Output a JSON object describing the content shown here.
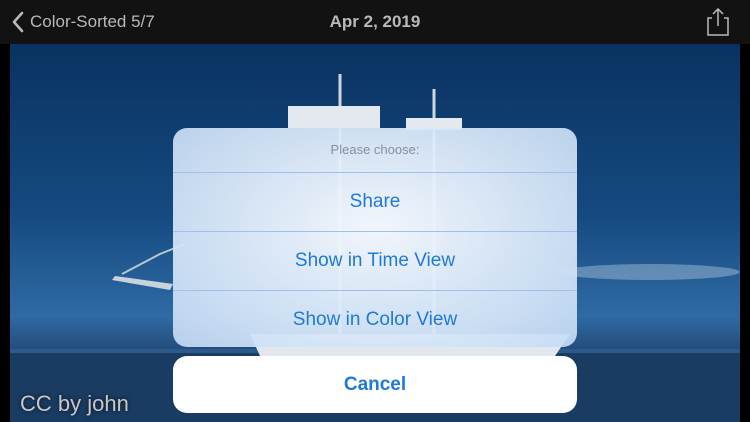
{
  "nav": {
    "back_label": "Color-Sorted 5/7",
    "title": "Apr 2, 2019"
  },
  "photo": {
    "credit": "CC by  john"
  },
  "action_sheet": {
    "title": "Please choose:",
    "actions": [
      {
        "label": "Share"
      },
      {
        "label": "Show in Time View"
      },
      {
        "label": "Show in Color View"
      }
    ],
    "cancel_label": "Cancel"
  },
  "icons": {
    "back": "chevron-left-icon",
    "share": "share-icon"
  },
  "colors": {
    "accent": "#1f79d6",
    "nav_bg": "#121212",
    "nav_text": "#b9b9b9"
  }
}
